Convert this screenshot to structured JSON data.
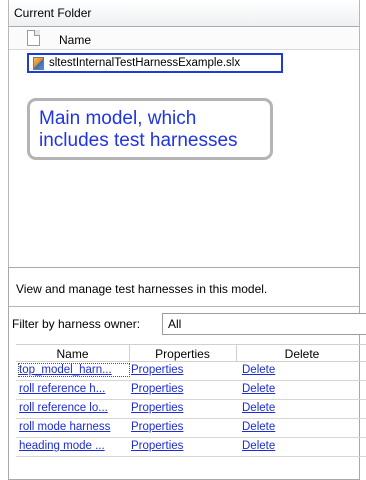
{
  "current_folder": {
    "title": "Current Folder",
    "column_header": "Name",
    "file": {
      "name": "sltestInternalTestHarnessExample.slx",
      "icon": "simulink-model-icon"
    }
  },
  "callout": {
    "line1": "Main model, which",
    "line2": "includes test harnesses"
  },
  "harness_dialog": {
    "description": "View and manage test harnesses in this model.",
    "filter_label": "Filter by harness owner:",
    "filter_value": "All",
    "columns": [
      "Name",
      "Properties",
      "Delete"
    ],
    "rows": [
      {
        "name": "top_model_harn...",
        "properties": "Properties",
        "delete": "Delete"
      },
      {
        "name": "roll reference h...",
        "properties": "Properties",
        "delete": "Delete"
      },
      {
        "name": "roll reference lo...",
        "properties": "Properties",
        "delete": "Delete"
      },
      {
        "name": "roll mode harness",
        "properties": "Properties",
        "delete": "Delete"
      },
      {
        "name": "heading mode ...",
        "properties": "Properties",
        "delete": "Delete"
      }
    ]
  },
  "colors": {
    "callout_text": "#1f35e3",
    "file_highlight": "#1e3bd7",
    "link": "#1c2dd6"
  }
}
